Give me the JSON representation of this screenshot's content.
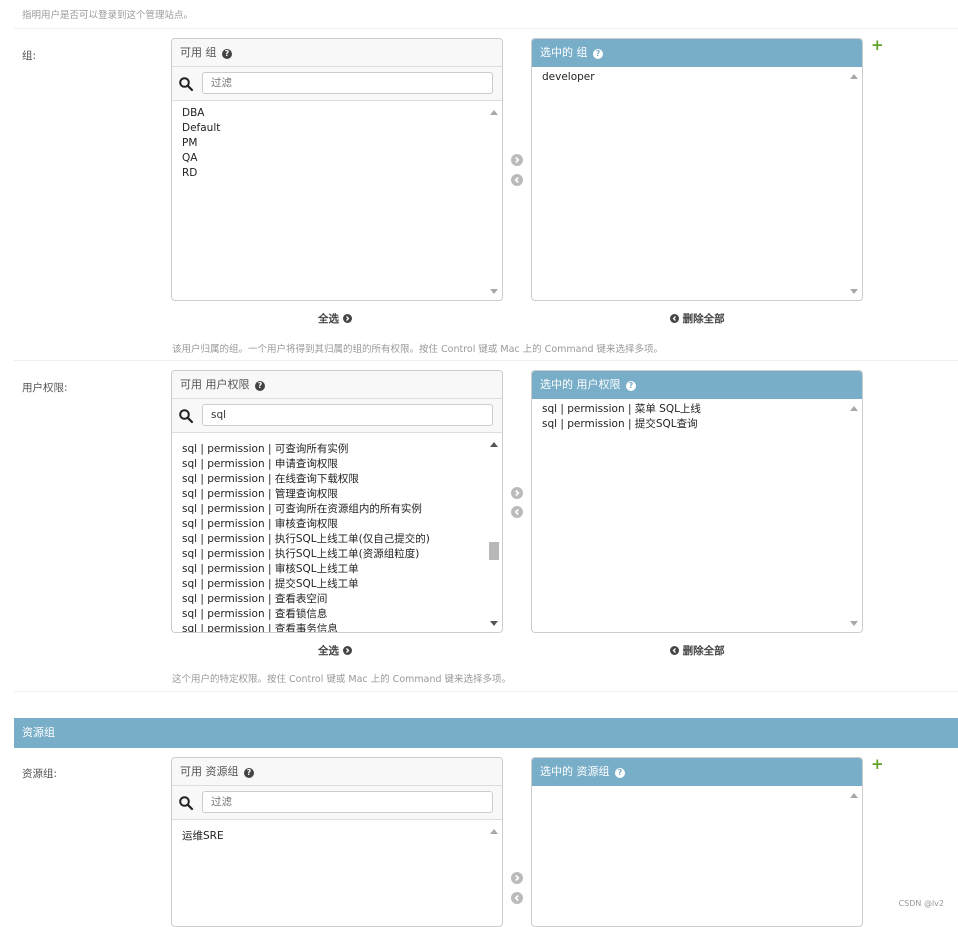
{
  "top_help": "指明用户是否可以登录到这个管理站点。",
  "groups": {
    "label": "组:",
    "available_title": "可用 组",
    "filter_placeholder": "过滤",
    "filter_value": "",
    "available": [
      "DBA",
      "Default",
      "PM",
      "QA",
      "RD"
    ],
    "chosen_title": "选中的 组",
    "chosen": [
      "developer"
    ],
    "choose_all": "全选",
    "remove_all": "删除全部",
    "help": "该用户归属的组。一个用户将得到其归属的组的所有权限。按住 Control 键或 Mac 上的 Command 键来选择多项。"
  },
  "perms": {
    "label": "用户权限:",
    "available_title": "可用 用户权限",
    "filter_placeholder": "过滤",
    "filter_value": "sql",
    "available": [
      "sql | permission | 可查询所有实例",
      "sql | permission | 申请查询权限",
      "sql | permission | 在线查询下载权限",
      "sql | permission | 管理查询权限",
      "sql | permission | 可查询所在资源组内的所有实例",
      "sql | permission | 审核查询权限",
      "sql | permission | 执行SQL上线工单(仅自己提交的)",
      "sql | permission | 执行SQL上线工单(资源组粒度)",
      "sql | permission | 审核SQL上线工单",
      "sql | permission | 提交SQL上线工单",
      "sql | permission | 查看表空间",
      "sql | permission | 查看锁信息",
      "sql | permission | 查看事务信息"
    ],
    "chosen_title": "选中的 用户权限",
    "chosen": [
      "sql | permission | 菜单 SQL上线",
      "sql | permission | 提交SQL查询"
    ],
    "choose_all": "全选",
    "remove_all": "删除全部",
    "help": "这个用户的特定权限。按住 Control 键或 Mac 上的 Command 键来选择多项。"
  },
  "resource_section": {
    "title": "资源组"
  },
  "resource": {
    "label": "资源组:",
    "available_title": "可用 资源组",
    "filter_placeholder": "过滤",
    "filter_value": "",
    "available": [
      "运维SRE"
    ],
    "chosen_title": "选中的 资源组",
    "chosen": []
  },
  "icons": {
    "help": "help-circle-icon",
    "filter": "search-icon",
    "move_right": "arrow-right-circle-icon",
    "move_left": "arrow-left-circle-icon",
    "add": "plus-icon"
  },
  "colors": {
    "header": "#79aec8",
    "add": "#5fa225",
    "help_text": "#999999"
  },
  "watermark": "CSDN @lv2"
}
